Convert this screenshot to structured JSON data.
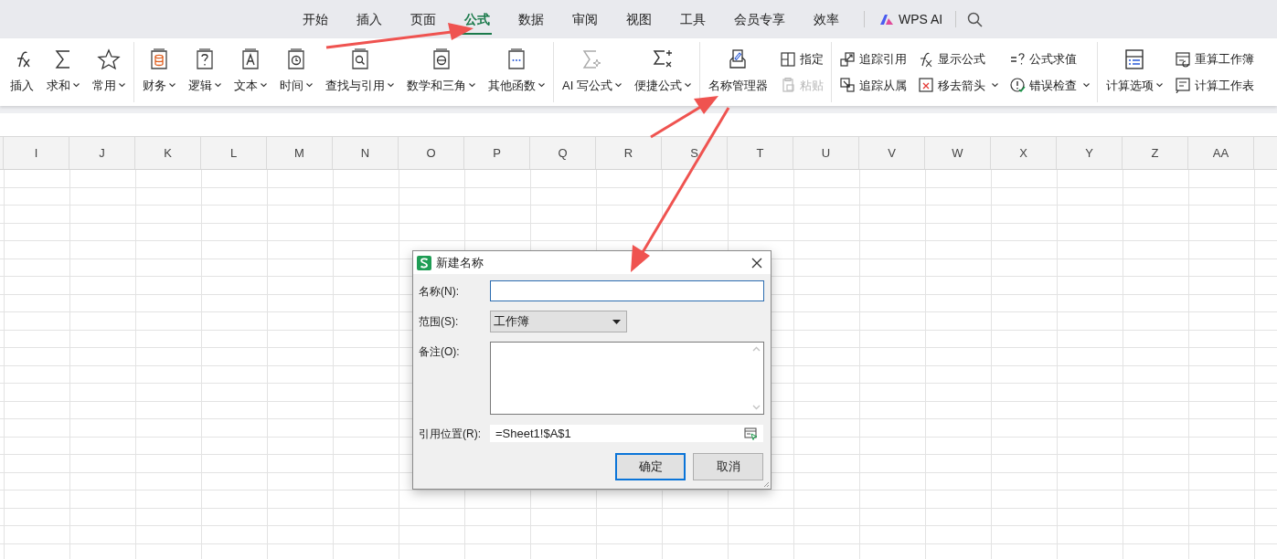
{
  "tabs": [
    {
      "label": "开始",
      "selected": false
    },
    {
      "label": "插入",
      "selected": false
    },
    {
      "label": "页面",
      "selected": false
    },
    {
      "label": "公式",
      "selected": true
    },
    {
      "label": "数据",
      "selected": false
    },
    {
      "label": "审阅",
      "selected": false
    },
    {
      "label": "视图",
      "selected": false
    },
    {
      "label": "工具",
      "selected": false
    },
    {
      "label": "会员专享",
      "selected": false
    },
    {
      "label": "效率",
      "selected": false
    }
  ],
  "ai_button": {
    "label": "WPS AI"
  },
  "ribbon": {
    "groups": [
      {
        "items": [
          {
            "kind": "large",
            "label": "插入",
            "dropdown": false,
            "disabled": false
          },
          {
            "kind": "large",
            "label": "求和",
            "dropdown": true,
            "disabled": false
          },
          {
            "kind": "large",
            "label": "常用",
            "dropdown": true,
            "disabled": false
          }
        ]
      },
      {
        "items": [
          {
            "kind": "large",
            "label": "财务",
            "dropdown": true,
            "disabled": false
          },
          {
            "kind": "large",
            "label": "逻辑",
            "dropdown": true,
            "disabled": false
          },
          {
            "kind": "large",
            "label": "文本",
            "dropdown": true,
            "disabled": false
          },
          {
            "kind": "large",
            "label": "时间",
            "dropdown": true,
            "disabled": false
          },
          {
            "kind": "large",
            "label": "查找与引用",
            "dropdown": true,
            "disabled": false
          },
          {
            "kind": "large",
            "label": "数学和三角",
            "dropdown": true,
            "disabled": false
          },
          {
            "kind": "large",
            "label": "其他函数",
            "dropdown": true,
            "disabled": false
          }
        ]
      },
      {
        "items": [
          {
            "kind": "large",
            "label": "AI 写公式",
            "dropdown": true,
            "disabled": false
          },
          {
            "kind": "large",
            "label": "便捷公式",
            "dropdown": true,
            "disabled": false
          }
        ]
      },
      {
        "items": [
          {
            "kind": "large",
            "label": "名称管理器",
            "dropdown": false,
            "disabled": false
          },
          {
            "kind": "stack",
            "items": [
              {
                "label": "指定",
                "dropdown": false,
                "disabled": false
              },
              {
                "label": "粘贴",
                "dropdown": false,
                "disabled": true
              }
            ]
          }
        ]
      },
      {
        "items": [
          {
            "kind": "stack",
            "items": [
              {
                "label": "追踪引用",
                "dropdown": false,
                "disabled": false
              },
              {
                "label": "追踪从属",
                "dropdown": false,
                "disabled": false
              }
            ]
          },
          {
            "kind": "stack",
            "items": [
              {
                "label": "显示公式",
                "dropdown": false,
                "disabled": false
              },
              {
                "label": "移去箭头",
                "dropdown": true,
                "disabled": false
              }
            ]
          },
          {
            "kind": "stack",
            "items": [
              {
                "label": "公式求值",
                "dropdown": false,
                "disabled": false
              },
              {
                "label": "错误检查",
                "dropdown": true,
                "disabled": false
              }
            ]
          }
        ]
      },
      {
        "items": [
          {
            "kind": "large",
            "label": "计算选项",
            "dropdown": true,
            "disabled": false
          },
          {
            "kind": "stack",
            "items": [
              {
                "label": "重算工作簿",
                "dropdown": false,
                "disabled": false
              },
              {
                "label": "计算工作表",
                "dropdown": false,
                "disabled": false
              }
            ]
          }
        ]
      }
    ]
  },
  "columns": [
    "I",
    "J",
    "K",
    "L",
    "M",
    "N",
    "O",
    "P",
    "Q",
    "R",
    "S",
    "T",
    "U",
    "V",
    "W",
    "X",
    "Y",
    "Z",
    "AA"
  ],
  "dialog": {
    "title": "新建名称",
    "name_field": {
      "label": "名称(N):"
    },
    "scope_field": {
      "label": "范围(S):",
      "value": "工作簿"
    },
    "comment_field": {
      "label": "备注(O):"
    },
    "refers_to_field": {
      "label": "引用位置(R):",
      "value": "=Sheet1!$A$1"
    },
    "buttons": [
      {
        "label": "确定",
        "default": true
      },
      {
        "label": "取消",
        "default": false
      }
    ]
  }
}
